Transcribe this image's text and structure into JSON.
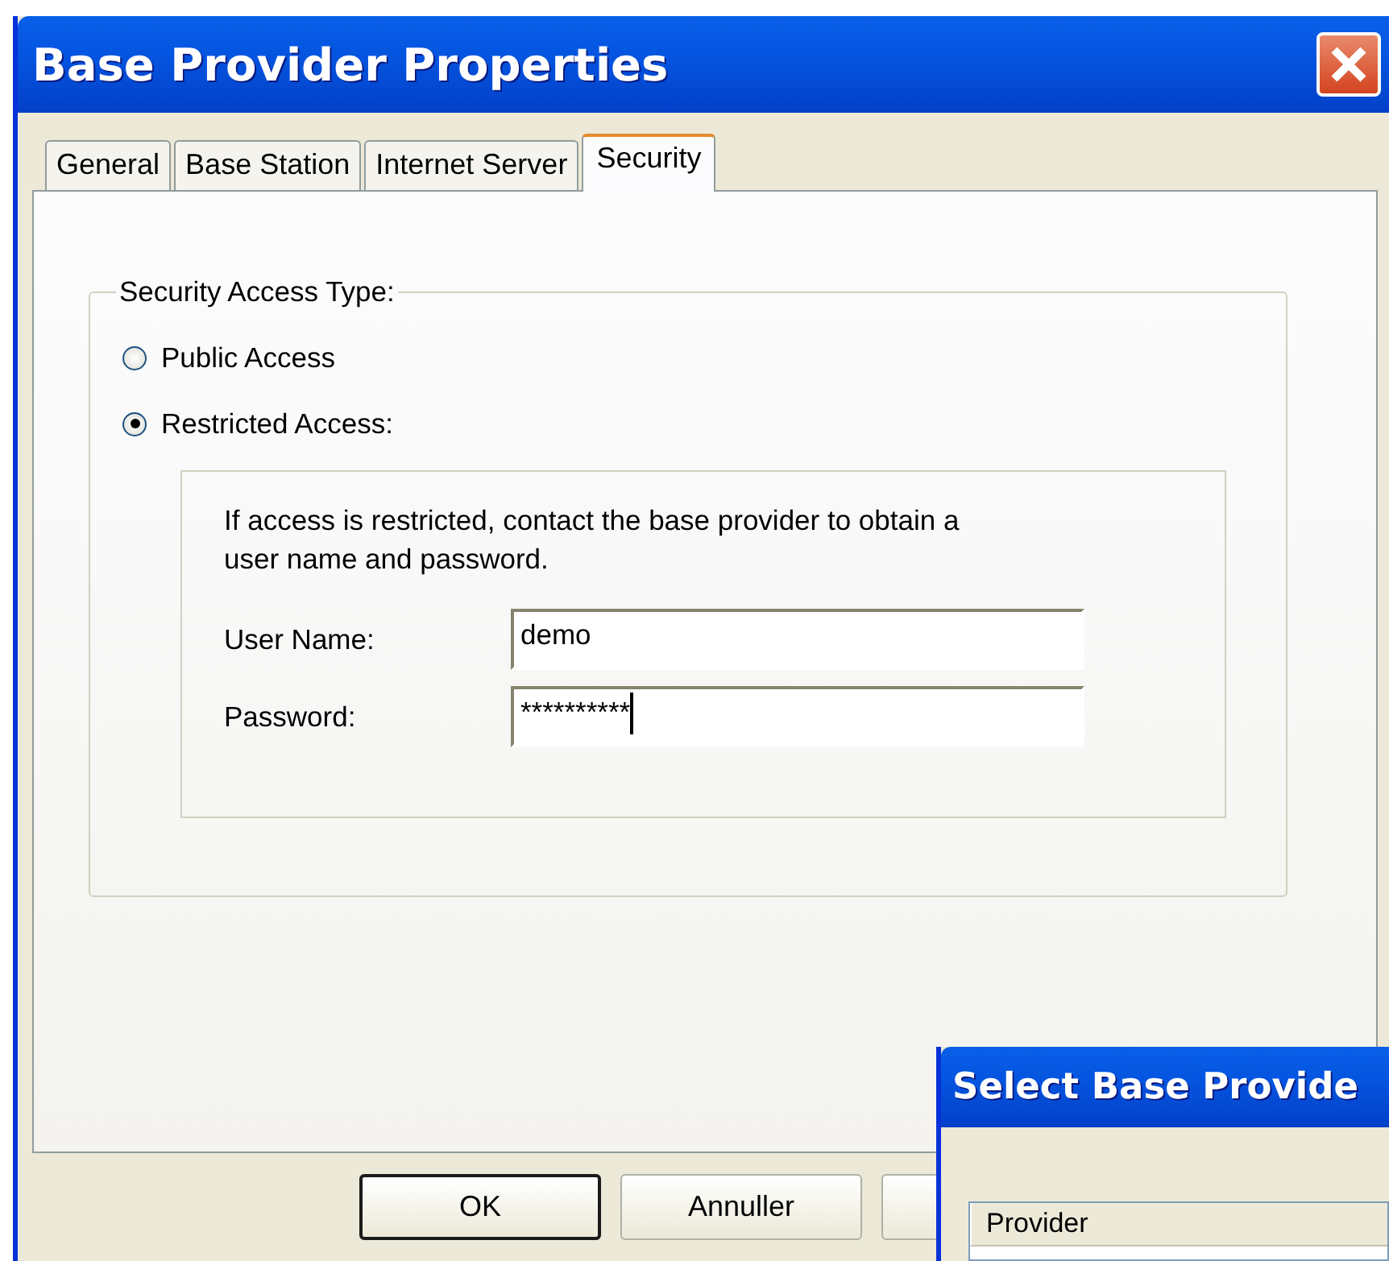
{
  "window": {
    "title": "Base Provider Properties"
  },
  "tabs": [
    {
      "label": "General",
      "selected": false
    },
    {
      "label": "Base Station",
      "selected": false
    },
    {
      "label": "Internet Server",
      "selected": false
    },
    {
      "label": "Security",
      "selected": true
    }
  ],
  "access_group": {
    "title": "Security Access Type:",
    "options": [
      {
        "label": "Public Access",
        "selected": false
      },
      {
        "label": "Restricted Access:",
        "selected": true
      }
    ]
  },
  "credentials": {
    "note": "If access is restricted, contact the base provider to obtain a user name and password.",
    "fields": [
      {
        "label": "User Name:",
        "value": "demo",
        "focused": false
      },
      {
        "label": "Password:",
        "value": "**********",
        "focused": true
      }
    ]
  },
  "buttons": [
    {
      "label": "OK",
      "default": true
    },
    {
      "label": "Annuller",
      "default": false
    },
    {
      "default": false
    }
  ],
  "second_window": {
    "title": "Select Base Provide",
    "table": {
      "columns": [
        "Provider"
      ]
    }
  }
}
